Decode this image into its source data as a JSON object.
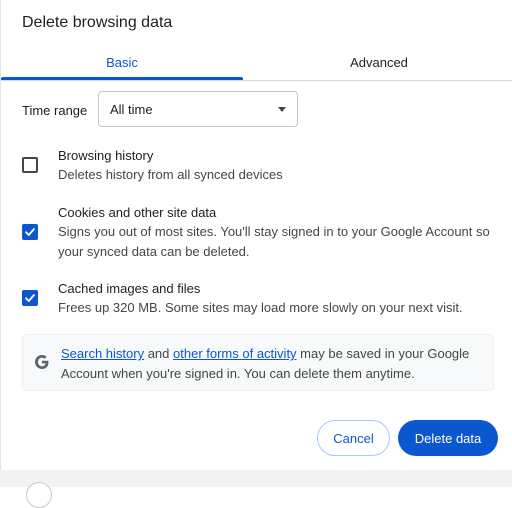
{
  "dialog": {
    "title": "Delete browsing data",
    "tabs": [
      {
        "label": "Basic",
        "selected": true
      },
      {
        "label": "Advanced",
        "selected": false
      }
    ],
    "time_range": {
      "label": "Time range",
      "value": "All time"
    },
    "options": [
      {
        "title": "Browsing history",
        "description": "Deletes history from all synced devices",
        "checked": false
      },
      {
        "title": "Cookies and other site data",
        "description": "Signs you out of most sites. You'll stay signed in to your Google Account so your synced data can be deleted.",
        "checked": true
      },
      {
        "title": "Cached images and files",
        "description": "Frees up 320 MB. Some sites may load more slowly on your next visit.",
        "checked": true
      }
    ],
    "notice": {
      "icon": "google-g-icon",
      "link1": "Search history",
      "middle": " and ",
      "link2": "other forms of activity",
      "rest": " may be saved in your Google Account when you're signed in. You can delete them anytime."
    },
    "buttons": {
      "cancel": "Cancel",
      "delete": "Delete data"
    },
    "colors": {
      "accent": "#0b57d0"
    }
  }
}
